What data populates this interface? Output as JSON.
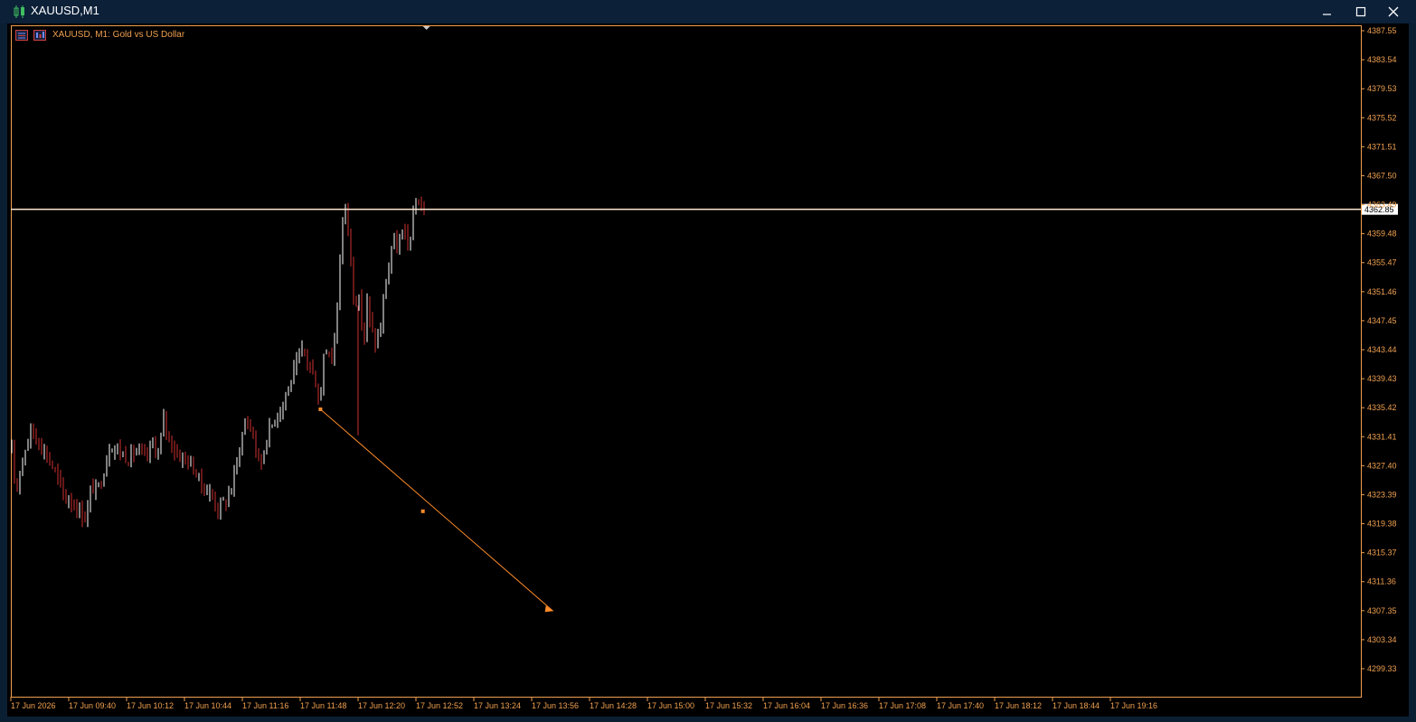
{
  "window": {
    "title": "XAUUSD,M1"
  },
  "chart": {
    "label": "XAUUSD, M1:  Gold vs US Dollar",
    "current_price": "4362.85",
    "colors": {
      "up": "#ffffff",
      "down": "#d03030",
      "line": "#ff8c2a",
      "price_line": "#ffe8d0",
      "axis": "#f0a050"
    }
  },
  "chart_data": {
    "type": "candlestick",
    "symbol": "XAUUSD",
    "timeframe": "M1",
    "y_ticks": [
      "4387.55",
      "4383.54",
      "4379.53",
      "4375.52",
      "4371.51",
      "4367.50",
      "4363.49",
      "4359.48",
      "4355.47",
      "4351.46",
      "4347.45",
      "4343.44",
      "4339.43",
      "4335.42",
      "4331.41",
      "4327.40",
      "4323.39",
      "4319.38",
      "4315.37",
      "4311.36",
      "4307.35",
      "4303.34",
      "4299.33"
    ],
    "x_ticks": [
      "17 Jun 2026",
      "17 Jun 09:40",
      "17 Jun 10:12",
      "17 Jun 10:44",
      "17 Jun 11:16",
      "17 Jun 11:48",
      "17 Jun 12:20",
      "17 Jun 12:52",
      "17 Jun 13:24",
      "17 Jun 13:56",
      "17 Jun 14:28",
      "17 Jun 15:00",
      "17 Jun 15:32",
      "17 Jun 16:04",
      "17 Jun 16:36",
      "17 Jun 17:08",
      "17 Jun 17:40",
      "17 Jun 18:12",
      "17 Jun 18:44",
      "17 Jun 19:16"
    ],
    "ylim": [
      4296.5,
      4389.0
    ],
    "price_line": 4362.85,
    "close_path": [
      {
        "t": 0,
        "p": 4329.2
      },
      {
        "t": 0.07,
        "p": 4323.3
      },
      {
        "t": 0.12,
        "p": 4326.4
      },
      {
        "t": 0.22,
        "p": 4329.5
      },
      {
        "t": 0.33,
        "p": 4332.4
      },
      {
        "t": 0.5,
        "p": 4330.4
      },
      {
        "t": 0.7,
        "p": 4327.4
      },
      {
        "t": 0.85,
        "p": 4324.4
      },
      {
        "t": 0.95,
        "p": 4322.5
      },
      {
        "t": 1.0,
        "p": 4323.0
      },
      {
        "t": 1.12,
        "p": 4321.5
      },
      {
        "t": 1.2,
        "p": 4320.9
      },
      {
        "t": 1.28,
        "p": 4320.0
      },
      {
        "t": 1.37,
        "p": 4324.4
      },
      {
        "t": 1.48,
        "p": 4324.0
      },
      {
        "t": 1.58,
        "p": 4326.4
      },
      {
        "t": 1.7,
        "p": 4330.4
      },
      {
        "t": 1.85,
        "p": 4329.5
      },
      {
        "t": 2.0,
        "p": 4328.4
      },
      {
        "t": 2.15,
        "p": 4329.5
      },
      {
        "t": 2.3,
        "p": 4328.4
      },
      {
        "t": 2.45,
        "p": 4330.4
      },
      {
        "t": 2.55,
        "p": 4329.0
      },
      {
        "t": 2.62,
        "p": 4334.0
      },
      {
        "t": 2.7,
        "p": 4331.5
      },
      {
        "t": 2.85,
        "p": 4329.0
      },
      {
        "t": 3.0,
        "p": 4328.4
      },
      {
        "t": 3.15,
        "p": 4327.0
      },
      {
        "t": 3.3,
        "p": 4324.4
      },
      {
        "t": 3.45,
        "p": 4323.4
      },
      {
        "t": 3.55,
        "p": 4321.5
      },
      {
        "t": 3.7,
        "p": 4322.5
      },
      {
        "t": 3.8,
        "p": 4324.4
      },
      {
        "t": 3.95,
        "p": 4330.4
      },
      {
        "t": 4.05,
        "p": 4334.0
      },
      {
        "t": 4.15,
        "p": 4332.4
      },
      {
        "t": 4.25,
        "p": 4328.4
      },
      {
        "t": 4.32,
        "p": 4328.0
      },
      {
        "t": 4.4,
        "p": 4331.4
      },
      {
        "t": 4.55,
        "p": 4334.0
      },
      {
        "t": 4.7,
        "p": 4336.5
      },
      {
        "t": 4.8,
        "p": 4338.6
      },
      {
        "t": 4.95,
        "p": 4342.0
      },
      {
        "t": 5.05,
        "p": 4343.4
      },
      {
        "t": 5.15,
        "p": 4341.0
      },
      {
        "t": 5.25,
        "p": 4339.0
      },
      {
        "t": 5.33,
        "p": 4335.5
      },
      {
        "t": 5.4,
        "p": 4344.4
      },
      {
        "t": 5.5,
        "p": 4343.0
      },
      {
        "t": 5.55,
        "p": 4342.0
      },
      {
        "t": 5.63,
        "p": 4350.0
      },
      {
        "t": 5.7,
        "p": 4360.5
      },
      {
        "t": 5.78,
        "p": 4363.5
      },
      {
        "t": 5.84,
        "p": 4357.5
      },
      {
        "t": 5.9,
        "p": 4351.4
      },
      {
        "t": 5.96,
        "p": 4350.4
      },
      {
        "t": 6.02,
        "p": 4349.5
      },
      {
        "t": 6.08,
        "p": 4344.0
      },
      {
        "t": 6.14,
        "p": 4350.4
      },
      {
        "t": 6.2,
        "p": 4346.4
      },
      {
        "t": 6.28,
        "p": 4344.5
      },
      {
        "t": 6.36,
        "p": 4345.5
      },
      {
        "t": 6.44,
        "p": 4351.4
      },
      {
        "t": 6.5,
        "p": 4354.5
      },
      {
        "t": 6.58,
        "p": 4358.5
      },
      {
        "t": 6.66,
        "p": 4357.5
      },
      {
        "t": 6.75,
        "p": 4359.5
      },
      {
        "t": 6.85,
        "p": 4358.0
      },
      {
        "t": 6.92,
        "p": 4360.5
      },
      {
        "t": 7.0,
        "p": 4364.5
      },
      {
        "t": 7.06,
        "p": 4363.5
      },
      {
        "t": 7.12,
        "p": 4362.85
      }
    ],
    "spike_low": {
      "t": 6.0,
      "p": 4331.6
    },
    "trendline": {
      "start": {
        "t": 5.35,
        "p": 4335.2
      },
      "mid": {
        "t": 7.12,
        "p": 4321.1
      },
      "end": {
        "t": 9.37,
        "p": 4307.3
      }
    }
  }
}
